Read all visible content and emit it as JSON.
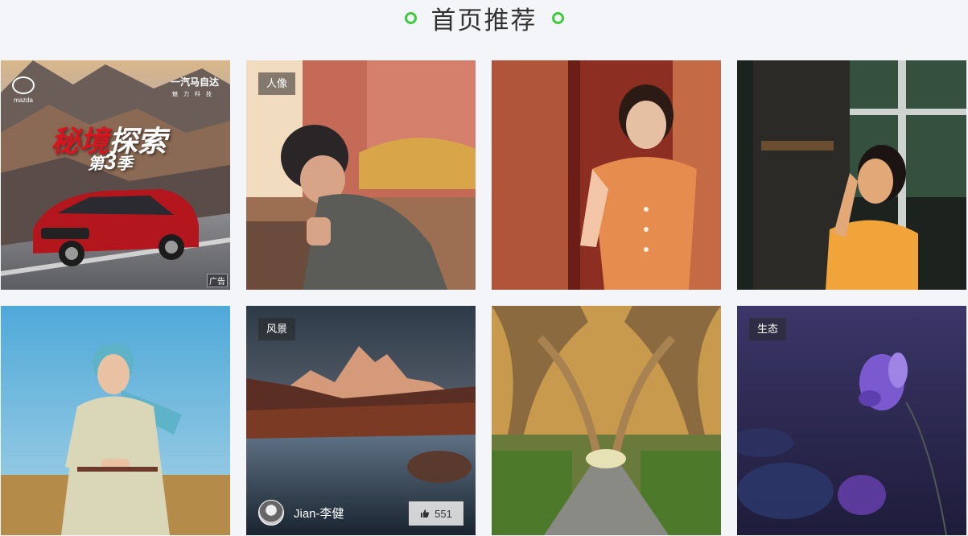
{
  "header": {
    "title": "首页推荐"
  },
  "colors": {
    "accent": "#3fca3f"
  },
  "tiles": [
    {
      "id": "ad",
      "ad": {
        "brand_left": "mazda",
        "brand_right": "一汽马自达",
        "brand_sub": "魅力科技",
        "headline_red": "秘境",
        "headline_white": "探索",
        "season_prefix": "第",
        "season_number": "3",
        "season_suffix": "季",
        "ad_mark": "广告"
      }
    },
    {
      "id": "portrait-1",
      "tag": "人像"
    },
    {
      "id": "portrait-2"
    },
    {
      "id": "portrait-3"
    },
    {
      "id": "portrait-4"
    },
    {
      "id": "landscape",
      "tag": "风景",
      "author": "Jian-李健",
      "likes": "551"
    },
    {
      "id": "forest"
    },
    {
      "id": "flower",
      "tag": "生态"
    }
  ]
}
